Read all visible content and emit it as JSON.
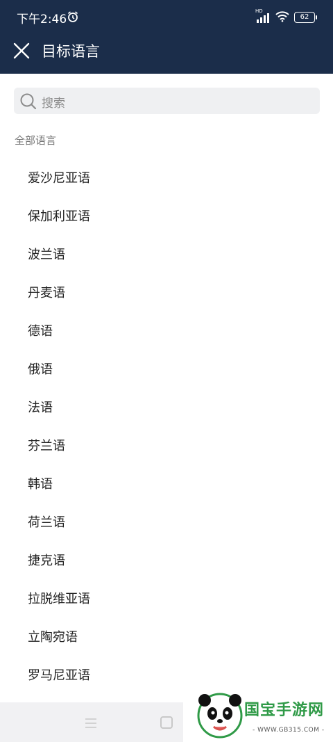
{
  "status_bar": {
    "time": "下午2:46",
    "hd": "HD",
    "battery": "62"
  },
  "header": {
    "title": "目标语言"
  },
  "search": {
    "placeholder": "搜索"
  },
  "section_title": "全部语言",
  "languages": [
    "爱沙尼亚语",
    "保加利亚语",
    "波兰语",
    "丹麦语",
    "德语",
    "俄语",
    "法语",
    "芬兰语",
    "韩语",
    "荷兰语",
    "捷克语",
    "拉脱维亚语",
    "立陶宛语",
    "罗马尼亚语"
  ],
  "watermark": {
    "text": "国宝手游网",
    "url": "- WWW.GB315.COM -"
  },
  "colors": {
    "header_bg": "#1b2d4a",
    "search_bg": "#eff0f2",
    "watermark_green": "#2f9a47"
  }
}
